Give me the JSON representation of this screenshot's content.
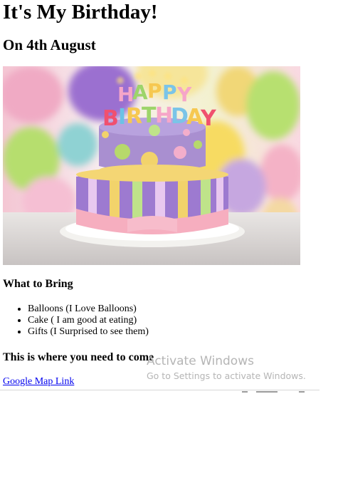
{
  "page": {
    "title": "It's My Birthday!",
    "subtitle": "On 4th August",
    "bring_heading": "What to Bring",
    "bring_items": [
      "Balloons (I Love Balloons)",
      "Cake ( I am good at eating)",
      "Gifts (I Surprised to see them)"
    ],
    "where_heading": "This is where you need to come",
    "map_link": "Google Map Link",
    "cake_text": "HAPPY BIRTHDAY"
  },
  "watermark": {
    "title": "Activate Windows",
    "subtitle": "Go to Settings to activate Windows."
  },
  "colors": {
    "cake_top": "#a98fd0",
    "cake_bottom_stripe_a": "#9d7ad0",
    "cake_bottom_stripe_b": "#f2d36b",
    "ribbon": "#f6aebf",
    "link": "#0000ee"
  }
}
